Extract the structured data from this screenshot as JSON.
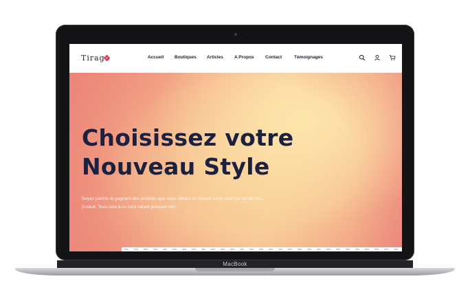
{
  "device": {
    "brand_label": "MacBook"
  },
  "site": {
    "logo_text": "Tirage",
    "nav": [
      {
        "label": "Accueil"
      },
      {
        "label": "Boutiques"
      },
      {
        "label": "Articles"
      },
      {
        "label": "A Propos"
      },
      {
        "label": "Contact"
      },
      {
        "label": "Témoignages"
      }
    ],
    "icons": [
      "search-icon",
      "user-icon",
      "cart-icon"
    ],
    "hero": {
      "title": "Choisissez votre Nouveau Style",
      "text": "Soyez parmis le gagnant des produits que nous offrons en faisant votre mise sur un de nos produit. Tous cela à un coût valant presque rien."
    },
    "colors": {
      "logo_accent": "#e0344b",
      "title": "#1d2140",
      "hero_peach": "#f9cf9c",
      "hero_coral": "#ee8f7e"
    }
  }
}
